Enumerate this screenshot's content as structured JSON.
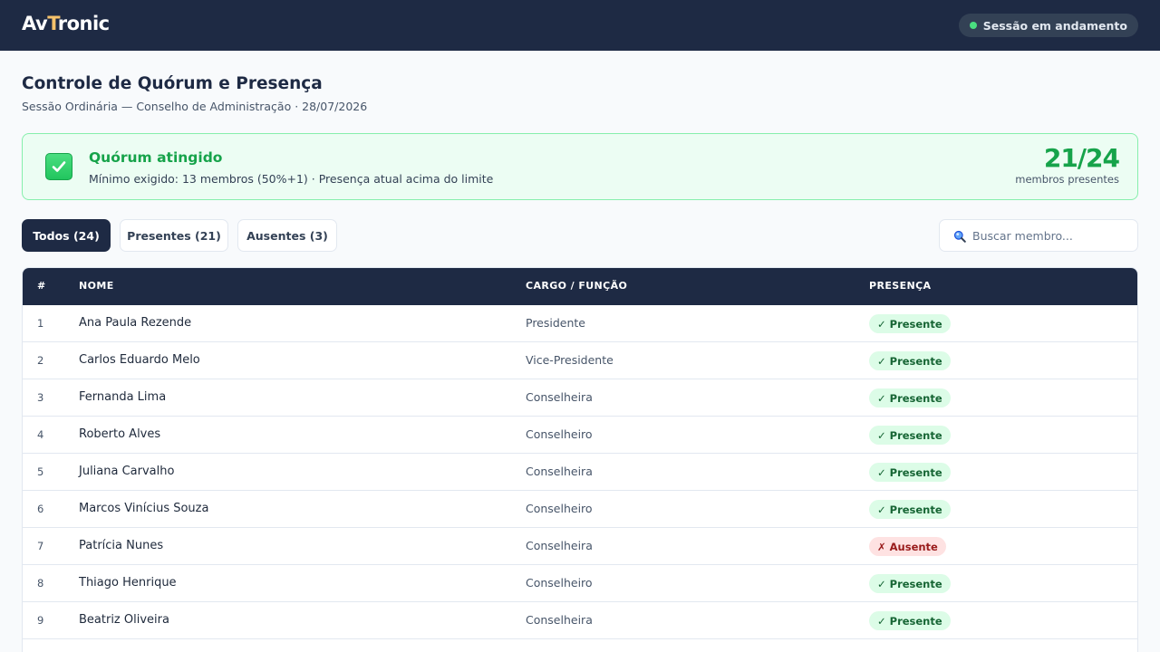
{
  "header": {
    "logo_prefix": "Av",
    "logo_accent": "T",
    "logo_suffix": "ronic",
    "session_status": "Sessão em andamento"
  },
  "page": {
    "title": "Controle de Quórum e Presença",
    "subtitle": "Sessão Ordinária — Conselho de Administração · 28/07/2026"
  },
  "quorum": {
    "title": "Quórum atingido",
    "description": "Mínimo exigido: 13 membros (50%+1) · Presença atual acima do limite",
    "count": "21/24",
    "count_label": "membros presentes"
  },
  "filters": {
    "all": "Todos (24)",
    "present": "Presentes (21)",
    "absent": "Ausentes (3)",
    "search_placeholder": "Buscar membro..."
  },
  "table": {
    "headers": {
      "num": "#",
      "name": "NOME",
      "role": "CARGO / FUNÇÃO",
      "presence": "PRESENÇA"
    },
    "rows": [
      {
        "num": "1",
        "name": "Ana Paula Rezende",
        "role": "Presidente",
        "status": "present",
        "status_label": "✓ Presente"
      },
      {
        "num": "2",
        "name": "Carlos Eduardo Melo",
        "role": "Vice-Presidente",
        "status": "present",
        "status_label": "✓ Presente"
      },
      {
        "num": "3",
        "name": "Fernanda Lima",
        "role": "Conselheira",
        "status": "present",
        "status_label": "✓ Presente"
      },
      {
        "num": "4",
        "name": "Roberto Alves",
        "role": "Conselheiro",
        "status": "present",
        "status_label": "✓ Presente"
      },
      {
        "num": "5",
        "name": "Juliana Carvalho",
        "role": "Conselheira",
        "status": "present",
        "status_label": "✓ Presente"
      },
      {
        "num": "6",
        "name": "Marcos Vinícius Souza",
        "role": "Conselheiro",
        "status": "present",
        "status_label": "✓ Presente"
      },
      {
        "num": "7",
        "name": "Patrícia Nunes",
        "role": "Conselheira",
        "status": "absent",
        "status_label": "✗ Ausente"
      },
      {
        "num": "8",
        "name": "Thiago Henrique",
        "role": "Conselheiro",
        "status": "present",
        "status_label": "✓ Presente"
      },
      {
        "num": "9",
        "name": "Beatriz Oliveira",
        "role": "Conselheira",
        "status": "present",
        "status_label": "✓ Presente"
      }
    ]
  },
  "colors": {
    "navy": "#1e2a44",
    "success": "#16a34a",
    "danger": "#991b1b"
  }
}
